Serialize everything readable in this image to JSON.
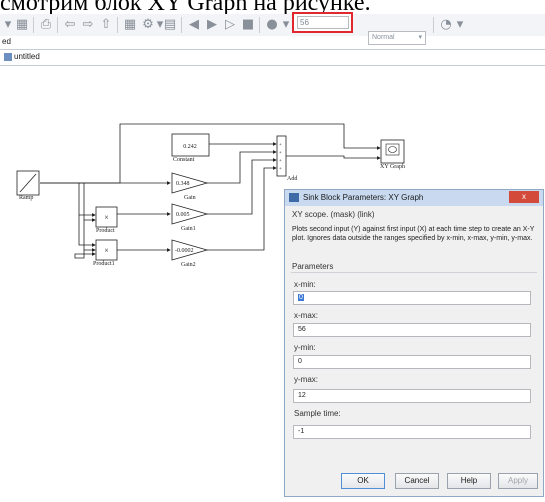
{
  "caption": {
    "text": "смотрим блок XY Graph на рисунке."
  },
  "toolbar": {
    "stop_time": "56",
    "sim_mode": "Normal",
    "icons": [
      "dropdown-arrow-icon",
      "new-model-icon",
      "print-icon",
      "back-icon",
      "forward-icon",
      "up-icon",
      "model-browser-icon",
      "settings-icon",
      "library-icon",
      "step-back-icon",
      "run-icon",
      "step-forward-icon",
      "stop-icon",
      "record-icon",
      "external-mode-icon"
    ]
  },
  "navigation": {
    "tab_label": "ed"
  },
  "breadcrumb": {
    "model_name": "untitled"
  },
  "model": {
    "blocks": {
      "constant": {
        "value": "0.242",
        "label": "Constant"
      },
      "gain": {
        "value": "0.348",
        "label": "Gain"
      },
      "gain1": {
        "value": "0.005",
        "label": "Gain1"
      },
      "gain2": {
        "value": "-0.0002",
        "label": "Gain2"
      },
      "ramp": {
        "label": "Ramp"
      },
      "product": {
        "label": "Product",
        "symbol": "×"
      },
      "product1": {
        "label": "Product1",
        "symbol": "×"
      },
      "add": {
        "label": "Add"
      },
      "xy_graph": {
        "label": "XY Graph"
      }
    }
  },
  "dialog": {
    "title": "Sink Block Parameters: XY Graph",
    "close_symbol": "x",
    "subtitle": "XY scope. (mask) (link)",
    "description": "Plots second input (Y) against first input (X) at each time step to create an X-Y plot. Ignores data outside the ranges specified by x-min, x-max, y-min, y-max.",
    "parameters_heading": "Parameters",
    "fields": [
      {
        "label": "x-min:",
        "value": "0"
      },
      {
        "label": "x-max:",
        "value": "56"
      },
      {
        "label": "y-min:",
        "value": "0"
      },
      {
        "label": "y-max:",
        "value": "12"
      },
      {
        "label": "Sample time:",
        "value": "-1"
      }
    ],
    "buttons": {
      "ok": "OK",
      "cancel": "Cancel",
      "help": "Help",
      "apply": "Apply"
    }
  },
  "colors": {
    "highlight_border": "#e0282e",
    "dialog_title_bar": "#c9daf0",
    "selection": "#3d7bd6",
    "close_button": "#d44a3a"
  }
}
